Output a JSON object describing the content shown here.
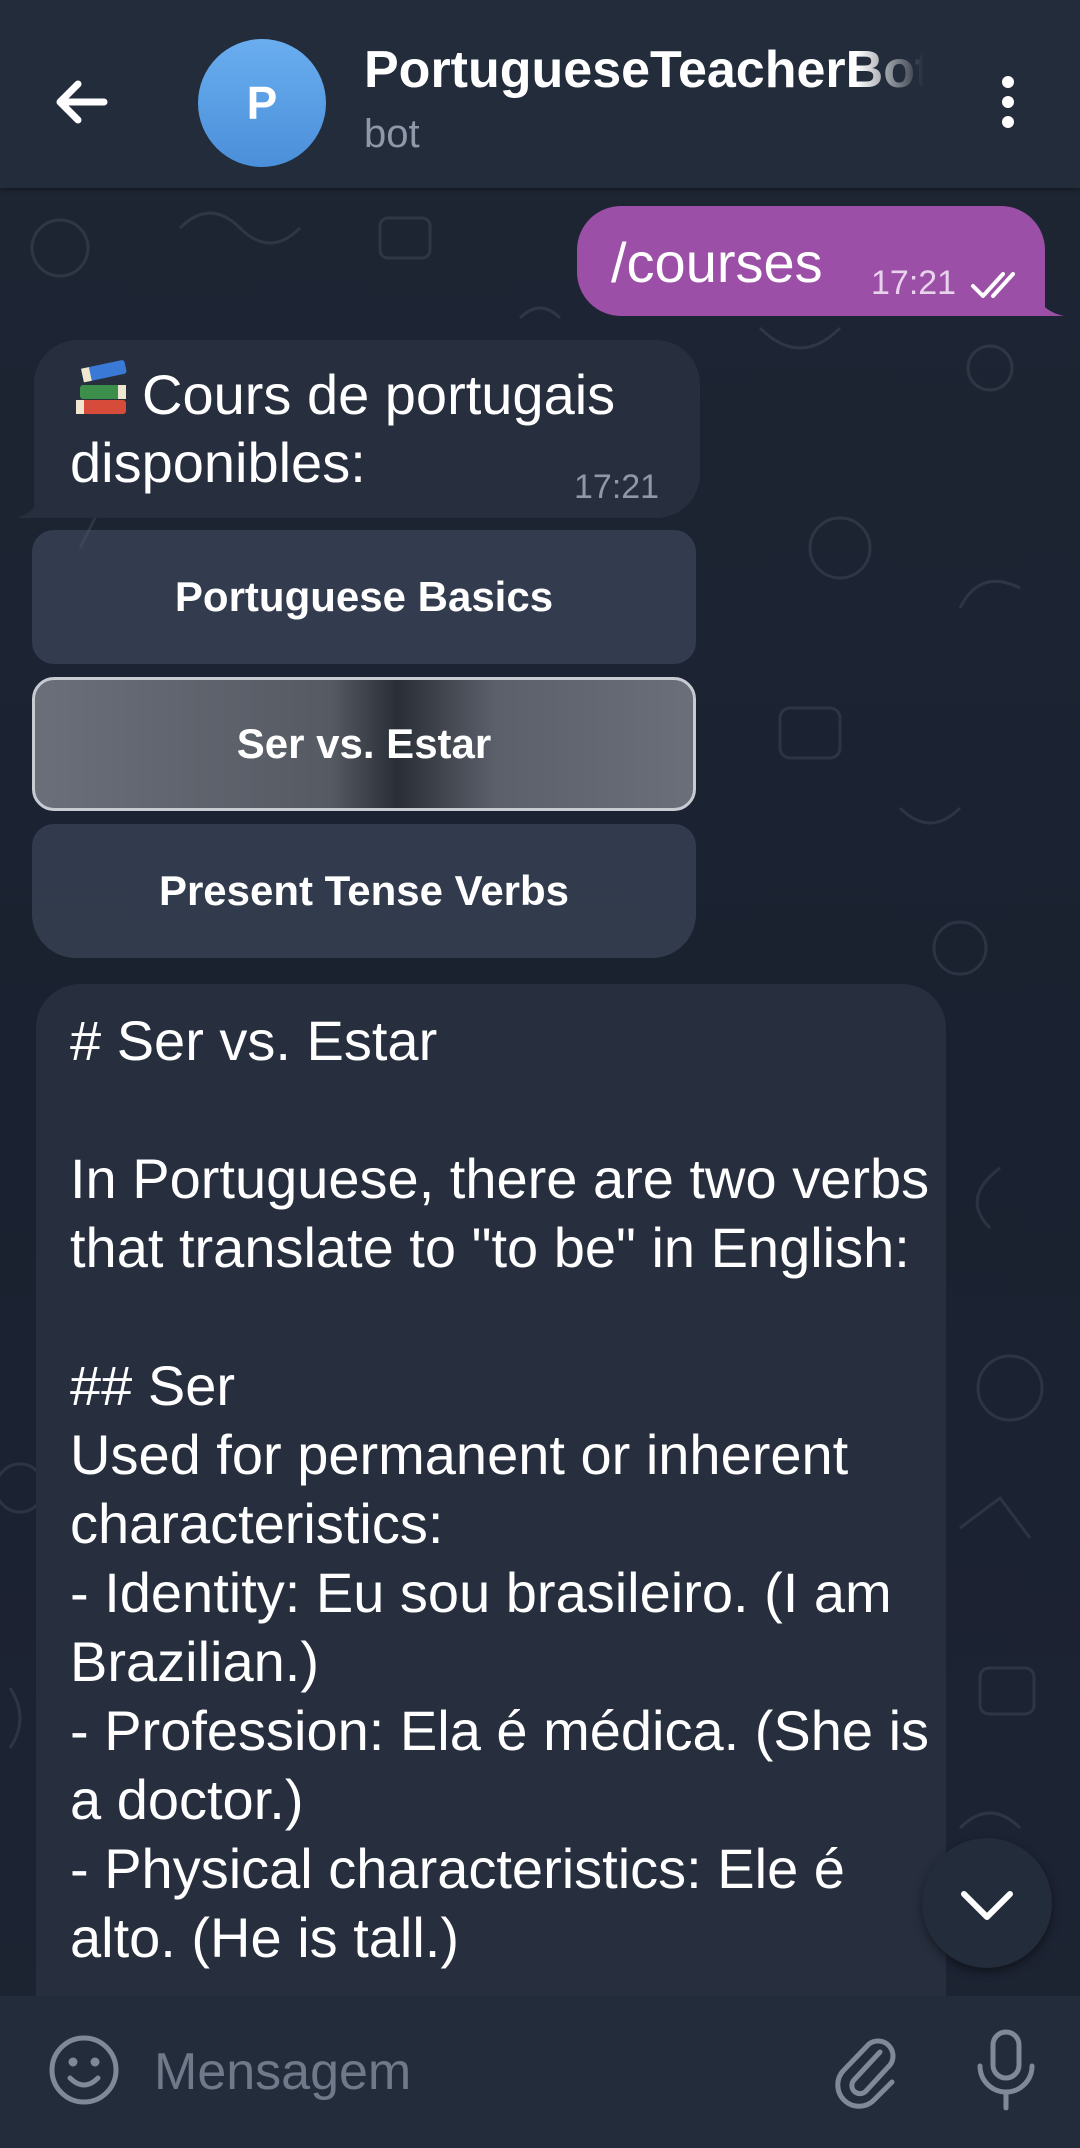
{
  "header": {
    "avatar_letter": "P",
    "title": "PortugueseTeacherBot",
    "subtitle": "bot",
    "back_icon": "arrow-left-icon",
    "menu_icon": "more-vertical-icon"
  },
  "messages": {
    "outgoing": {
      "text": "/courses",
      "time": "17:21",
      "status_icon": "double-check-icon"
    },
    "incoming": {
      "emoji_icon": "books-icon",
      "text": "Cours de portugais disponibles:",
      "time": "17:21"
    },
    "keyboard": [
      {
        "label": "Portuguese Basics"
      },
      {
        "label": "Ser vs. Estar"
      },
      {
        "label": "Present Tense Verbs"
      }
    ],
    "lesson": {
      "heading": "# Ser vs. Estar",
      "intro": "In Portuguese, there are two verbs that translate to \"to be\" in English:",
      "subheading": "## Ser",
      "desc": "Used for permanent or inherent characteristics:",
      "items": [
        "- Identity: Eu sou brasileiro. (I am Brazilian.)",
        "- Profession: Ela é médica. (She is a doctor.)",
        "- Physical characteristics: Ele é alto. (He is tall.)"
      ]
    }
  },
  "input": {
    "placeholder": "Mensagem",
    "emoji_icon": "smile-icon",
    "attach_icon": "paperclip-icon",
    "mic_icon": "microphone-icon"
  },
  "colors": {
    "header_bg": "#232c3b",
    "chat_bg": "#1b2230",
    "outgoing_bubble": "#9c4fa6",
    "incoming_bubble": "#272f3f",
    "avatar": "#5b9de3"
  }
}
